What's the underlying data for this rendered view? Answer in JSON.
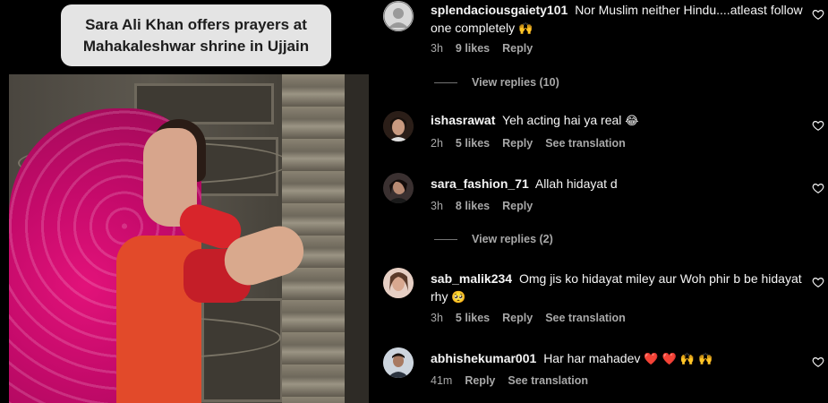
{
  "video": {
    "caption_line1": "Sara Ali Khan offers prayers at",
    "caption_line2": "Mahakaleshwar shrine in Ujjain"
  },
  "comments": [
    {
      "username": "splendaciousgaiety101",
      "text": "Nor Muslim neither Hindu....atleast follow one completely",
      "emoji": "🙌",
      "time": "3h",
      "likes": "9 likes",
      "reply": "Reply",
      "view_replies": "View replies (10)"
    },
    {
      "username": "ishasrawat",
      "text": "Yeh acting hai ya real",
      "emoji": "😂",
      "time": "2h",
      "likes": "5 likes",
      "reply": "Reply",
      "see_translation": "See translation"
    },
    {
      "username": "sara_fashion_71",
      "text": "Allah hidayat d",
      "time": "3h",
      "likes": "8 likes",
      "reply": "Reply",
      "view_replies": "View replies (2)"
    },
    {
      "username": "sab_malik234",
      "text": "Omg jis ko hidayat miley aur Woh phir b be hidayat rhy",
      "emoji": "🥺",
      "time": "3h",
      "likes": "5 likes",
      "reply": "Reply",
      "see_translation": "See translation"
    },
    {
      "username": "abhishekumar001",
      "text": "Har har mahadev",
      "emoji": "❤️ ❤️ 🙌 🙌",
      "time": "41m",
      "reply": "Reply",
      "see_translation": "See translation"
    }
  ],
  "colors": {
    "background": "#000000",
    "text": "#f5f5f5",
    "muted": "#a8a8a8",
    "caption_bg": "#e4e4e4"
  },
  "icons": [
    "heart-outline-icon"
  ]
}
